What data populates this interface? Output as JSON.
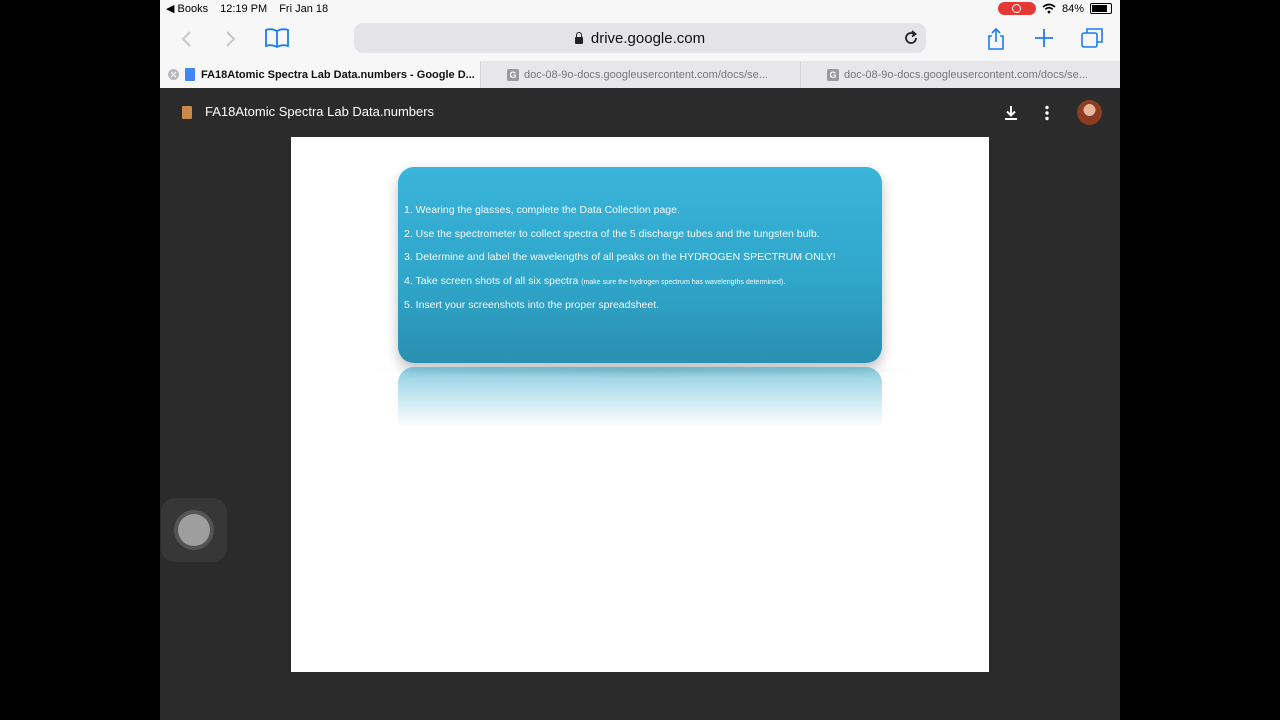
{
  "status_bar": {
    "back_app": "◀ Books",
    "time": "12:19 PM",
    "date": "Fri Jan 18",
    "battery": "84%",
    "battery_level": 0.84
  },
  "toolbar": {
    "url": "drive.google.com"
  },
  "tabs": [
    {
      "title": "FA18Atomic Spectra Lab Data.numbers - Google D...",
      "active": true
    },
    {
      "title": "doc-08-9o-docs.googleusercontent.com/docs/se...",
      "active": false
    },
    {
      "title": "doc-08-9o-docs.googleusercontent.com/docs/se...",
      "active": false
    }
  ],
  "tab_favicon_letter": "G",
  "drive": {
    "file_title": "FA18Atomic Spectra Lab Data.numbers"
  },
  "card": {
    "items": [
      {
        "text": "1. Wearing the glasses, complete the Data Collection page."
      },
      {
        "text": "2. Use the spectrometer to collect spectra of the 5 discharge tubes and the tungsten bulb."
      },
      {
        "text": "3. Determine and label the wavelengths of all peaks on the HYDROGEN SPECTRUM ONLY!"
      },
      {
        "text": "4. Take screen shots of all six spectra ",
        "small": "(make sure the hydrogen spectrum has wavelengths determined)",
        "end": "."
      },
      {
        "text": "5. Insert your screenshots into the proper spreadsheet."
      }
    ]
  },
  "colors": {
    "card_top": "#3ab4da",
    "card_bottom": "#2a8fb0",
    "record": "#e53935",
    "ios_blue": "#1a7cf5"
  }
}
